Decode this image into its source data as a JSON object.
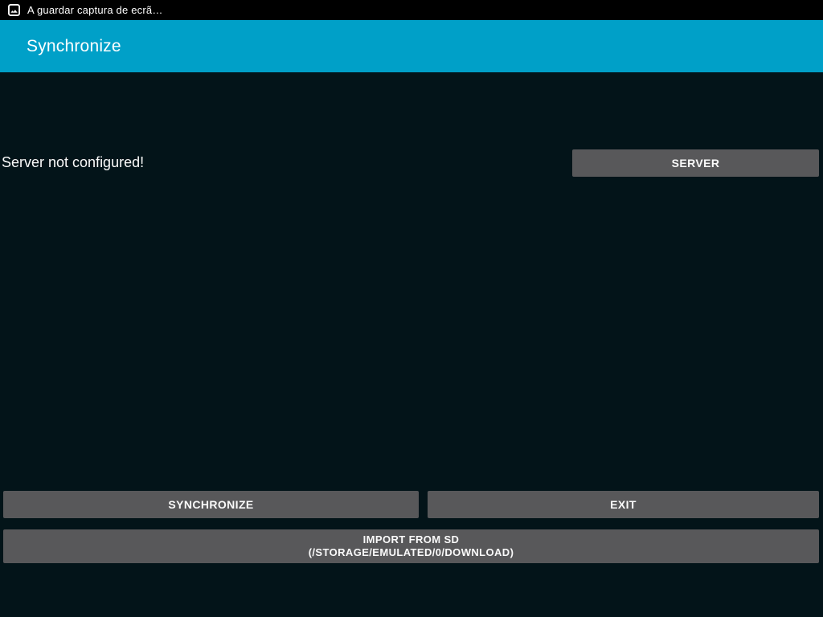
{
  "status_bar": {
    "notification_text": "A guardar captura de ecrã…",
    "icon": "image-icon"
  },
  "header": {
    "title": "Synchronize"
  },
  "main": {
    "status_message": "Server not configured!",
    "server_button_label": "SERVER",
    "synchronize_button_label": "SYNCHRONIZE",
    "exit_button_label": "EXIT",
    "import_button_line1": "IMPORT FROM SD",
    "import_button_line2": "(/STORAGE/EMULATED/0/DOWNLOAD)"
  },
  "colors": {
    "status_bar_bg": "#000000",
    "header_bg": "#00A0C8",
    "body_bg": "#031419",
    "button_bg": "#58585A",
    "text": "#FFFFFF"
  }
}
